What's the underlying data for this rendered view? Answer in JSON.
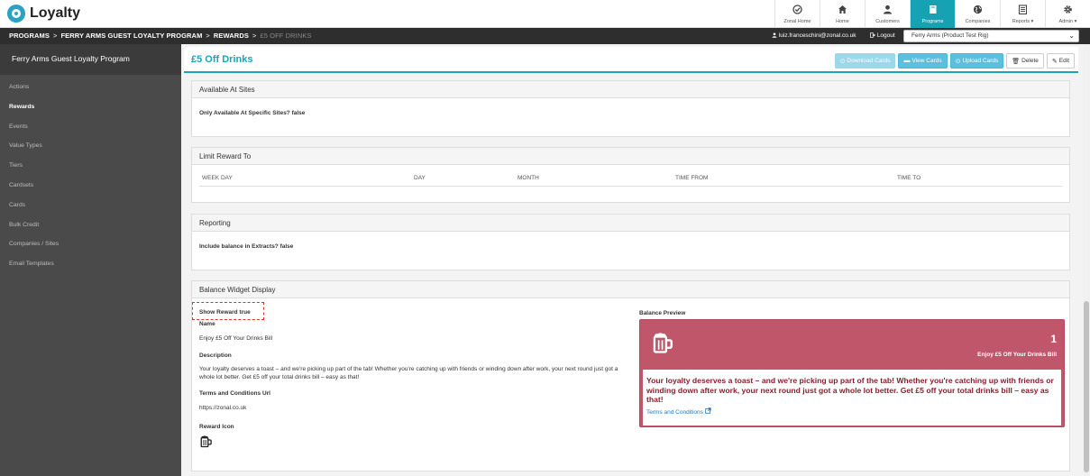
{
  "app": {
    "title": "Loyalty"
  },
  "nav": {
    "items": [
      {
        "label": "Zonal Home",
        "icon": "dashboard-check-icon",
        "active": false
      },
      {
        "label": "Home",
        "icon": "home-icon",
        "active": false
      },
      {
        "label": "Customers",
        "icon": "user-icon",
        "active": false
      },
      {
        "label": "Programs",
        "icon": "book-icon",
        "active": true
      },
      {
        "label": "Companies",
        "icon": "globe-icon",
        "active": false
      },
      {
        "label": "Reports ▾",
        "icon": "report-icon",
        "active": false
      },
      {
        "label": "Admin ▾",
        "icon": "cog-icon",
        "active": false
      }
    ]
  },
  "breadcrumb": {
    "items": [
      "PROGRAMS",
      "FERRY ARMS GUEST LOYALTY PROGRAM",
      "REWARDS"
    ],
    "current": "£5 OFF DRINKS",
    "separator": ">"
  },
  "user": {
    "email": "luiz.franceschini@zonal.co.uk",
    "logout_label": "Logout"
  },
  "site_select": {
    "value": "Ferry Arms (Product Test Rig)"
  },
  "sidebar": {
    "title": "Ferry Arms Guest Loyalty Program",
    "items": [
      {
        "label": "Actions",
        "active": false
      },
      {
        "label": "Rewards",
        "active": true
      },
      {
        "label": "Events",
        "active": false
      },
      {
        "label": "Value Types",
        "active": false
      },
      {
        "label": "Tiers",
        "active": false
      },
      {
        "label": "Cardsets",
        "active": false
      },
      {
        "label": "Cards",
        "active": false
      },
      {
        "label": "Bulk Credit",
        "active": false
      },
      {
        "label": "Companies / Sites",
        "active": false
      },
      {
        "label": "Email Templates",
        "active": false
      }
    ]
  },
  "page": {
    "title": "£5 Off Drinks",
    "actions": {
      "download": "Download Cards",
      "view": "View Cards",
      "upload": "Upload Cards",
      "delete": "Delete",
      "edit": "Edit"
    }
  },
  "available_at_sites": {
    "heading": "Available At Sites",
    "text": "Only Available At Specific Sites? false"
  },
  "limit_reward": {
    "heading": "Limit Reward To",
    "columns": [
      "WEEK DAY",
      "DAY",
      "MONTH",
      "TIME FROM",
      "TIME TO"
    ]
  },
  "reporting": {
    "heading": "Reporting",
    "text": "Include balance in Extracts? false"
  },
  "balance_widget": {
    "heading": "Balance Widget Display",
    "show_reward": "Show Reward true",
    "name_label": "Name",
    "name_value": "Enjoy £5 Off Your Drinks Bill",
    "description_label": "Description",
    "description_value": "Your loyalty deserves a toast – and we're picking up part of the tab! Whether you're catching up with friends or winding down after work, your next round just got a whole lot better. Get £5 off your total drinks bill – easy as that!",
    "terms_label": "Terms and Conditions Url",
    "terms_value": "https://zonal.co.uk",
    "icon_label": "Reward Icon",
    "icon": "beer-mug-icon"
  },
  "preview": {
    "label": "Balance Preview",
    "count": "1",
    "name": "Enjoy £5 Off Your Drinks Bill",
    "description": "Your loyalty deserves a toast – and we're picking up part of the tab! Whether you're catching up with friends or winding down after work, your next round just got a whole lot better. Get £5 off your total drinks bill – easy as that!",
    "terms_link": "Terms and Conditions",
    "bg_color": "#c0566a",
    "text_color": "#8b1e2e"
  },
  "colors": {
    "accent": "#1aa6b7",
    "button_info": "#5bc0de",
    "highlight_dashed": "#d9342b"
  }
}
